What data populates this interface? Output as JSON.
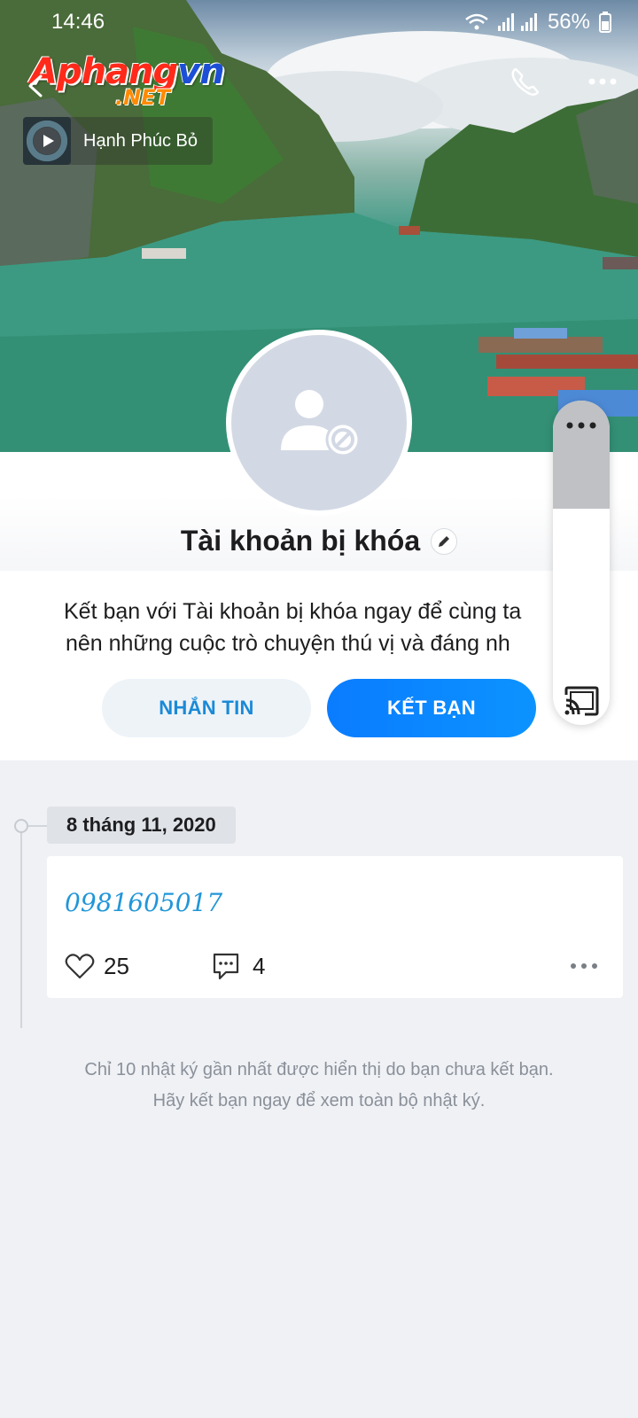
{
  "status_bar": {
    "time": "14:46",
    "battery": "56%"
  },
  "header": {
    "logo_main_1": "Aphang",
    "logo_main_2": "vn",
    "logo_sub": ".NET",
    "music_title": "Hạnh Phúc Bỏ"
  },
  "profile": {
    "name": "Tài khoản bị khóa",
    "intro_line1": "Kết bạn với Tài khoản bị khóa ngay để cùng ta",
    "intro_line2": "nên những cuộc trò chuyện thú vị và đáng nh",
    "message_button": "NHẮN TIN",
    "add_friend_button": "KẾT BẠN"
  },
  "timeline": {
    "date": "8 tháng 11, 2020",
    "post": {
      "text": "0981605017",
      "likes": "25",
      "comments": "4"
    },
    "footer_line1": "Chỉ 10 nhật ký gần nhất được hiển thị do bạn chưa kết bạn.",
    "footer_line2": "Hãy kết bạn ngay để xem toàn bộ nhật ký."
  },
  "colors": {
    "accent_blue": "#0a7cff",
    "link_blue": "#2196d8",
    "background": "#eff1f5"
  },
  "icons": [
    "wifi-icon",
    "signal-icon",
    "battery-icon",
    "back-icon",
    "call-icon",
    "more-icon",
    "play-icon",
    "blocked-user-icon",
    "edit-icon",
    "heart-icon",
    "comment-icon",
    "cast-icon"
  ]
}
